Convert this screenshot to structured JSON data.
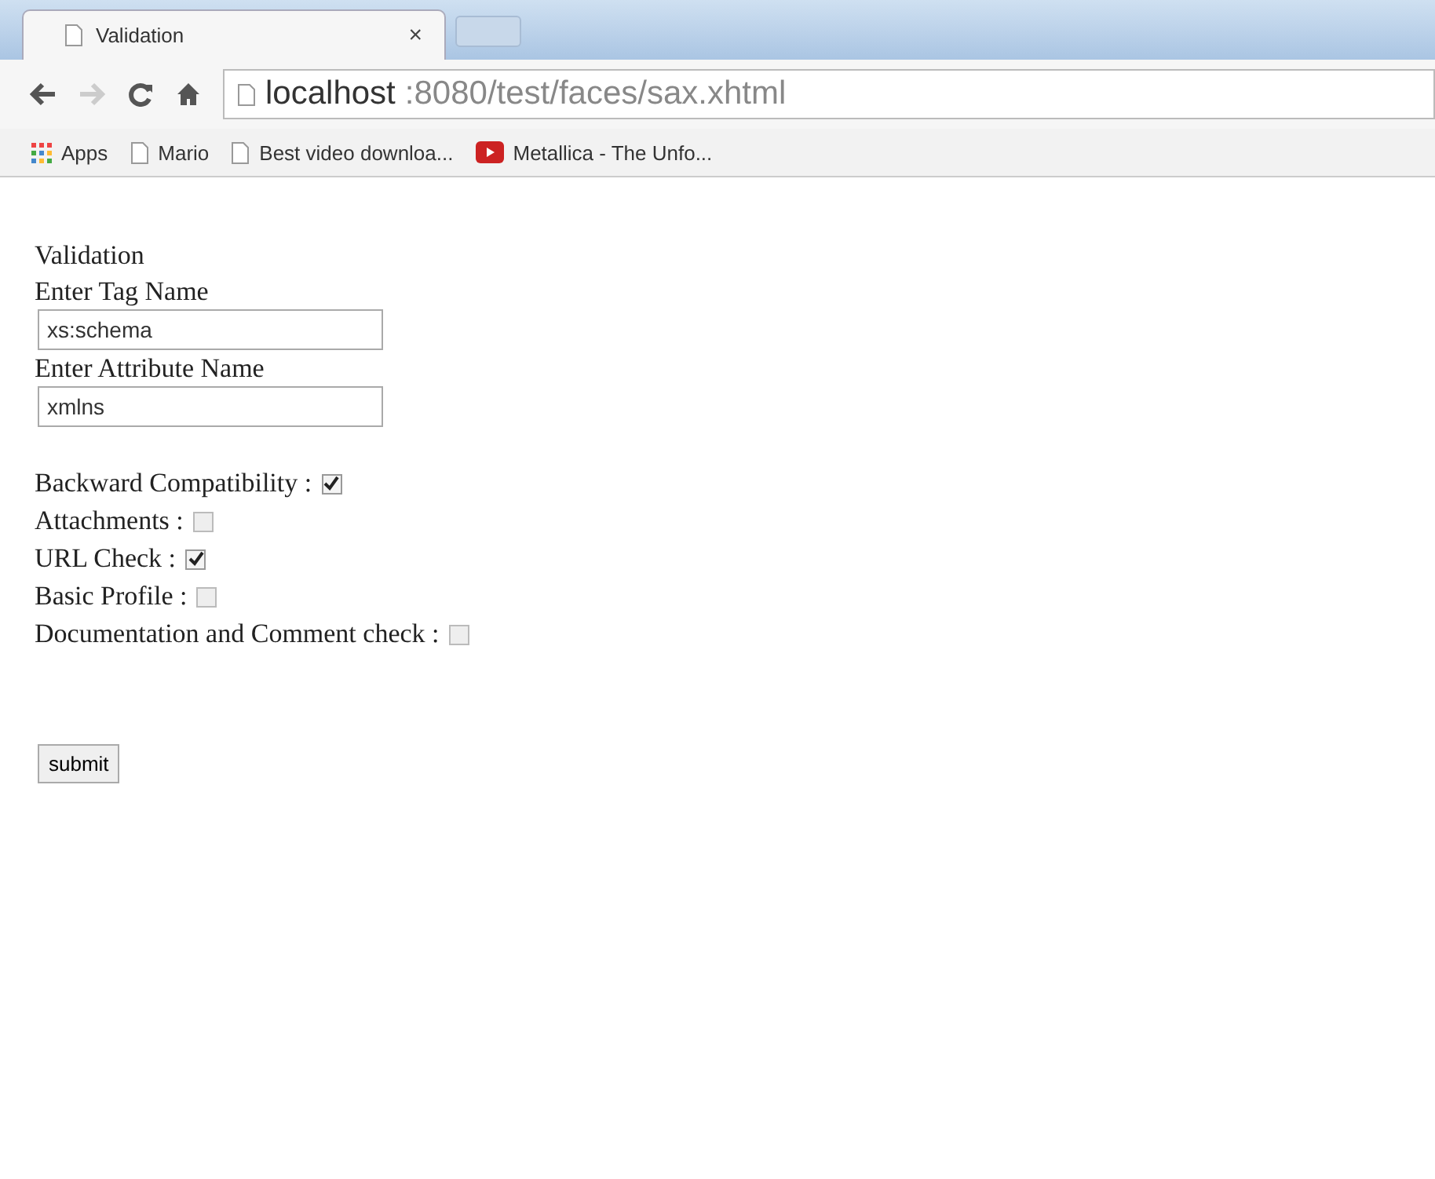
{
  "browser": {
    "tab": {
      "title": "Validation",
      "close": "×"
    },
    "address": {
      "host": "localhost",
      "path": ":8080/test/faces/sax.xhtml"
    },
    "bookmarks": [
      {
        "kind": "apps",
        "label": "Apps"
      },
      {
        "kind": "page",
        "label": "Mario"
      },
      {
        "kind": "page",
        "label": "Best video downloa..."
      },
      {
        "kind": "video",
        "label": "Metallica - The Unfo..."
      }
    ]
  },
  "page": {
    "heading": "Validation",
    "fields": [
      {
        "label": "Enter Tag Name",
        "value": "xs:schema"
      },
      {
        "label": "Enter Attribute Name",
        "value": "xmlns"
      }
    ],
    "options": [
      {
        "label": "Backward Compatibility :",
        "checked": true
      },
      {
        "label": "Attachments :",
        "checked": false
      },
      {
        "label": "URL Check :",
        "checked": true
      },
      {
        "label": "Basic Profile :",
        "checked": false
      },
      {
        "label": "Documentation and Comment check :",
        "checked": false
      }
    ],
    "submit": "submit"
  }
}
